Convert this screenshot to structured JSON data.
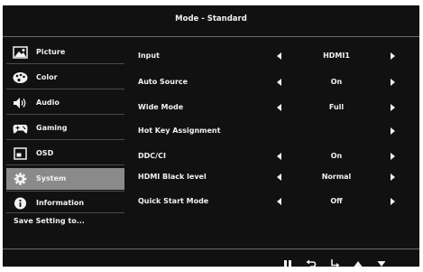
{
  "title": "Mode - Standard",
  "sidebar": {
    "items": [
      {
        "label": "Picture",
        "icon": "picture-icon"
      },
      {
        "label": "Color",
        "icon": "palette-icon"
      },
      {
        "label": "Audio",
        "icon": "speaker-icon"
      },
      {
        "label": "Gaming",
        "icon": "gamepad-icon"
      },
      {
        "label": "OSD",
        "icon": "osd-icon"
      },
      {
        "label": "System",
        "icon": "gear-icon",
        "selected": true
      },
      {
        "label": "Information",
        "icon": "info-icon"
      }
    ],
    "save_label": "Save Setting to..."
  },
  "settings": [
    {
      "label": "Input",
      "value": "HDMI1"
    },
    {
      "label": "Auto Source",
      "value": "On"
    },
    {
      "label": "Wide Mode",
      "value": "Full"
    },
    {
      "label": "Hot Key Assignment",
      "value": ""
    },
    {
      "label": "DDC/CI",
      "value": "On"
    },
    {
      "label": "HDMI Black level",
      "value": "Normal"
    },
    {
      "label": "Quick Start Mode",
      "value": "Off"
    }
  ],
  "buttons": [
    "pause-icon",
    "back-icon",
    "enter-icon",
    "up-icon",
    "down-icon"
  ],
  "colors": {
    "background": "#111111",
    "selected": "#8a8a8a",
    "text": "#f2f2f2",
    "divider": "#6b6b6b"
  }
}
